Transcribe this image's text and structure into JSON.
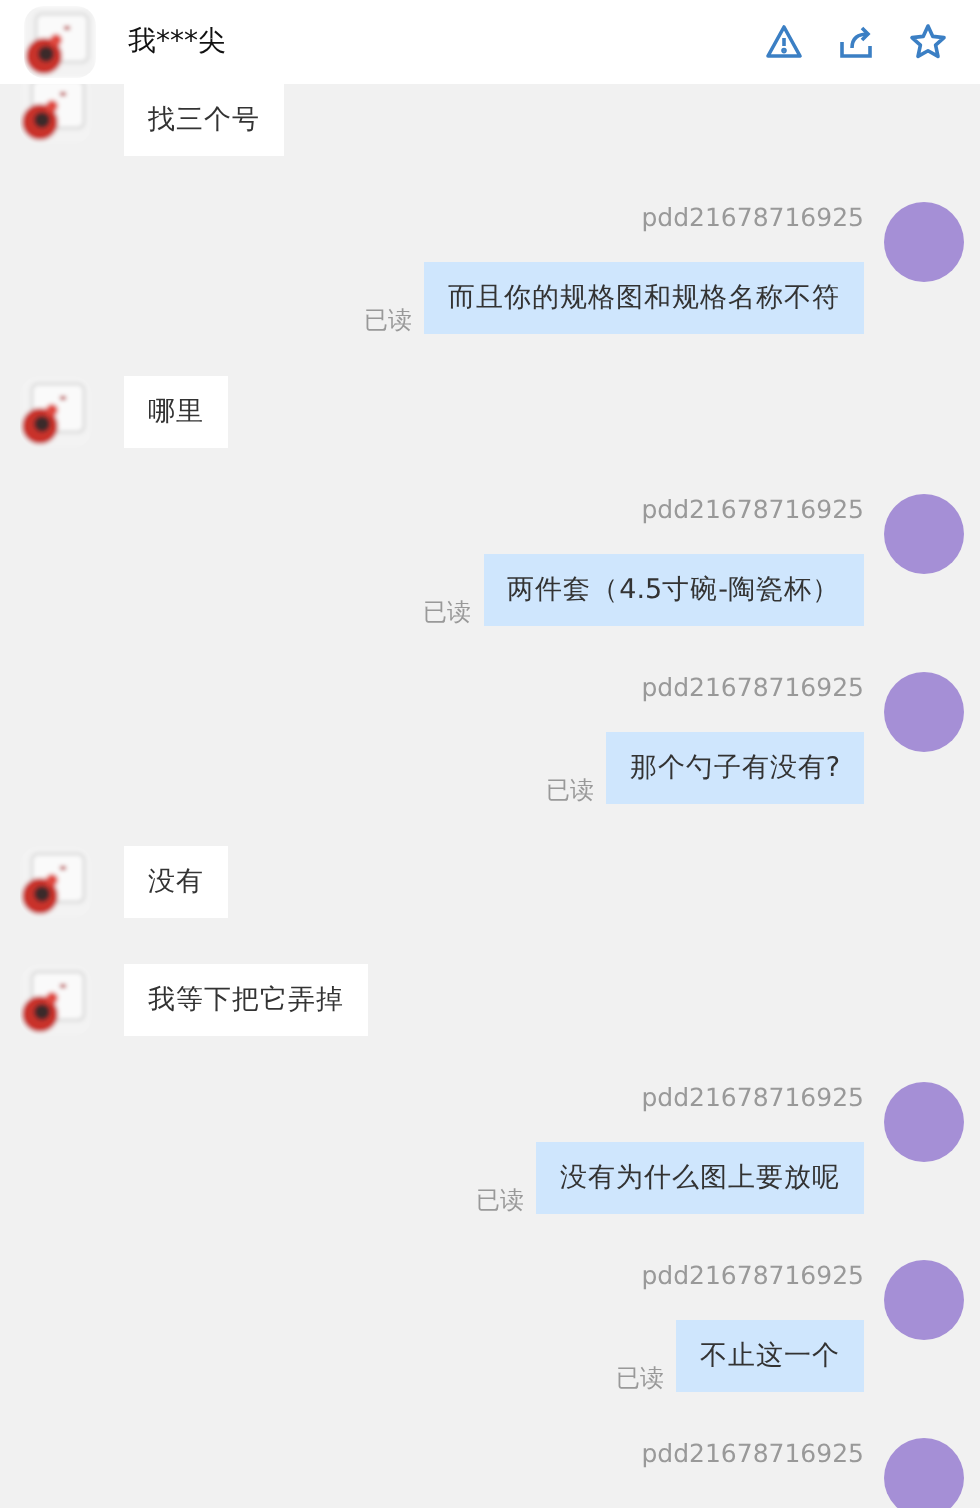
{
  "header": {
    "title": "我***尖"
  },
  "messages": [
    {
      "kind": "incoming",
      "text": "找三个号"
    },
    {
      "kind": "outgoing",
      "sender": "pdd21678716925",
      "text": "而且你的规格图和规格名称不符",
      "status": "已读"
    },
    {
      "kind": "incoming",
      "text": "哪里"
    },
    {
      "kind": "outgoing",
      "sender": "pdd21678716925",
      "text": "两件套（4.5寸碗-陶瓷杯）",
      "status": "已读"
    },
    {
      "kind": "outgoing",
      "sender": "pdd21678716925",
      "text": "那个勺子有没有?",
      "status": "已读"
    },
    {
      "kind": "incoming",
      "text": "没有"
    },
    {
      "kind": "incoming",
      "text": "我等下把它弄掉"
    },
    {
      "kind": "outgoing",
      "sender": "pdd21678716925",
      "text": "没有为什么图上要放呢",
      "status": "已读"
    },
    {
      "kind": "outgoing",
      "sender": "pdd21678716925",
      "text": "不止这一个",
      "status": "已读"
    },
    {
      "kind": "outgoing",
      "sender": "pdd21678716925"
    }
  ]
}
